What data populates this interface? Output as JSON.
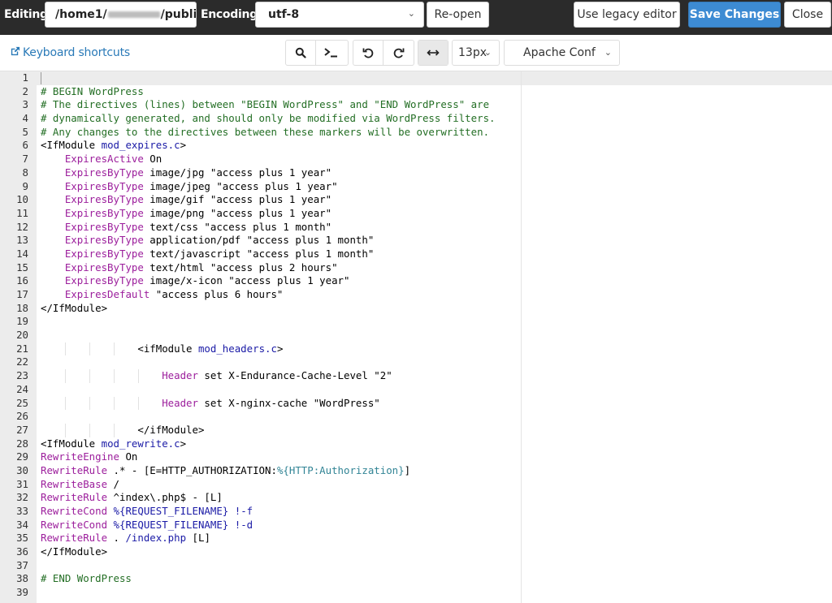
{
  "topbar": {
    "editing_label": "Editing:",
    "path_prefix": "/home1/",
    "path_suffix": "/publi",
    "encoding_label": "Encoding:",
    "encoding_value": "utf-8",
    "reopen_label": "Re-open",
    "legacy_label": "Use legacy editor",
    "save_label": "Save Changes",
    "close_label": "Close",
    "accent_color": "#3d8bd3"
  },
  "toolbar": {
    "keyboard_shortcuts_label": "Keyboard shortcuts",
    "font_size_value": "13px",
    "mode_value": "Apache Conf",
    "icons": [
      "search-icon",
      "terminal-icon",
      "undo-icon",
      "redo-icon",
      "wrap-toggle-icon"
    ]
  },
  "editor": {
    "lines": [
      {
        "n": "1",
        "tokens": []
      },
      {
        "n": "2",
        "tokens": [
          {
            "t": "# BEGIN WordPress",
            "c": "c-comment"
          }
        ]
      },
      {
        "n": "3",
        "tokens": [
          {
            "t": "# The directives (lines) between \"BEGIN WordPress\" and \"END WordPress\" are",
            "c": "c-comment"
          }
        ]
      },
      {
        "n": "4",
        "tokens": [
          {
            "t": "# dynamically generated, and should only be modified via WordPress filters.",
            "c": "c-comment"
          }
        ]
      },
      {
        "n": "5",
        "tokens": [
          {
            "t": "# Any changes to the directives between these markers will be overwritten.",
            "c": "c-comment"
          }
        ]
      },
      {
        "n": "6",
        "tokens": [
          {
            "t": "<IfModule ",
            "c": ""
          },
          {
            "t": "mod_expires.c",
            "c": "c-mod"
          },
          {
            "t": ">",
            "c": ""
          }
        ]
      },
      {
        "n": "7",
        "tokens": [
          {
            "t": "    ",
            "c": ""
          },
          {
            "t": "ExpiresActive",
            "c": "c-kw"
          },
          {
            "t": " On",
            "c": ""
          }
        ]
      },
      {
        "n": "8",
        "tokens": [
          {
            "t": "    ",
            "c": ""
          },
          {
            "t": "ExpiresByType",
            "c": "c-kw"
          },
          {
            "t": " image/jpg \"access plus 1 year\"",
            "c": ""
          }
        ]
      },
      {
        "n": "9",
        "tokens": [
          {
            "t": "    ",
            "c": ""
          },
          {
            "t": "ExpiresByType",
            "c": "c-kw"
          },
          {
            "t": " image/jpeg \"access plus 1 year\"",
            "c": ""
          }
        ]
      },
      {
        "n": "10",
        "tokens": [
          {
            "t": "    ",
            "c": ""
          },
          {
            "t": "ExpiresByType",
            "c": "c-kw"
          },
          {
            "t": " image/gif \"access plus 1 year\"",
            "c": ""
          }
        ]
      },
      {
        "n": "11",
        "tokens": [
          {
            "t": "    ",
            "c": ""
          },
          {
            "t": "ExpiresByType",
            "c": "c-kw"
          },
          {
            "t": " image/png \"access plus 1 year\"",
            "c": ""
          }
        ]
      },
      {
        "n": "12",
        "tokens": [
          {
            "t": "    ",
            "c": ""
          },
          {
            "t": "ExpiresByType",
            "c": "c-kw"
          },
          {
            "t": " text/css \"access plus 1 month\"",
            "c": ""
          }
        ]
      },
      {
        "n": "13",
        "tokens": [
          {
            "t": "    ",
            "c": ""
          },
          {
            "t": "ExpiresByType",
            "c": "c-kw"
          },
          {
            "t": " application/pdf \"access plus 1 month\"",
            "c": ""
          }
        ]
      },
      {
        "n": "14",
        "tokens": [
          {
            "t": "    ",
            "c": ""
          },
          {
            "t": "ExpiresByType",
            "c": "c-kw"
          },
          {
            "t": " text/javascript \"access plus 1 month\"",
            "c": ""
          }
        ]
      },
      {
        "n": "15",
        "tokens": [
          {
            "t": "    ",
            "c": ""
          },
          {
            "t": "ExpiresByType",
            "c": "c-kw"
          },
          {
            "t": " text/html \"access plus 2 hours\"",
            "c": ""
          }
        ]
      },
      {
        "n": "16",
        "tokens": [
          {
            "t": "    ",
            "c": ""
          },
          {
            "t": "ExpiresByType",
            "c": "c-kw"
          },
          {
            "t": " image/x-icon \"access plus 1 year\"",
            "c": ""
          }
        ]
      },
      {
        "n": "17",
        "tokens": [
          {
            "t": "    ",
            "c": ""
          },
          {
            "t": "ExpiresDefault",
            "c": "c-kw"
          },
          {
            "t": " \"access plus 6 hours\"",
            "c": ""
          }
        ]
      },
      {
        "n": "18",
        "tokens": [
          {
            "t": "</IfModule>",
            "c": ""
          }
        ]
      },
      {
        "n": "19",
        "tokens": []
      },
      {
        "n": "20",
        "tokens": []
      },
      {
        "n": "21",
        "guides": 3,
        "tokens": [
          {
            "t": "                ",
            "c": ""
          },
          {
            "t": "<ifModule ",
            "c": ""
          },
          {
            "t": "mod_headers.c",
            "c": "c-mod"
          },
          {
            "t": ">",
            "c": ""
          }
        ]
      },
      {
        "n": "22",
        "tokens": []
      },
      {
        "n": "23",
        "guides": 4,
        "tokens": [
          {
            "t": "                    ",
            "c": ""
          },
          {
            "t": "Header",
            "c": "c-kw"
          },
          {
            "t": " set X-Endurance-Cache-Level \"2\"",
            "c": ""
          }
        ]
      },
      {
        "n": "24",
        "tokens": []
      },
      {
        "n": "25",
        "guides": 4,
        "tokens": [
          {
            "t": "                    ",
            "c": ""
          },
          {
            "t": "Header",
            "c": "c-kw"
          },
          {
            "t": " set X-nginx-cache \"WordPress\"",
            "c": ""
          }
        ]
      },
      {
        "n": "26",
        "tokens": []
      },
      {
        "n": "27",
        "guides": 3,
        "tokens": [
          {
            "t": "                ",
            "c": ""
          },
          {
            "t": "</ifModule>",
            "c": ""
          }
        ]
      },
      {
        "n": "28",
        "tokens": [
          {
            "t": "<IfModule ",
            "c": ""
          },
          {
            "t": "mod_rewrite.c",
            "c": "c-mod"
          },
          {
            "t": ">",
            "c": ""
          }
        ]
      },
      {
        "n": "29",
        "tokens": [
          {
            "t": "RewriteEngine",
            "c": "c-kw"
          },
          {
            "t": " On",
            "c": ""
          }
        ]
      },
      {
        "n": "30",
        "tokens": [
          {
            "t": "RewriteRule",
            "c": "c-kw"
          },
          {
            "t": " .* - [E=HTTP_AUTHORIZATION:",
            "c": ""
          },
          {
            "t": "%{HTTP:Authorization}",
            "c": "c-var"
          },
          {
            "t": "]",
            "c": ""
          }
        ]
      },
      {
        "n": "31",
        "tokens": [
          {
            "t": "RewriteBase",
            "c": "c-kw"
          },
          {
            "t": " /",
            "c": ""
          }
        ]
      },
      {
        "n": "32",
        "tokens": [
          {
            "t": "RewriteRule",
            "c": "c-kw"
          },
          {
            "t": " ^index\\.php$ - [L]",
            "c": ""
          }
        ]
      },
      {
        "n": "33",
        "tokens": [
          {
            "t": "RewriteCond",
            "c": "c-kw"
          },
          {
            "t": " ",
            "c": ""
          },
          {
            "t": "%{REQUEST_FILENAME}",
            "c": "c-var2"
          },
          {
            "t": " !-f",
            "c": "c-var2"
          }
        ]
      },
      {
        "n": "34",
        "tokens": [
          {
            "t": "RewriteCond",
            "c": "c-kw"
          },
          {
            "t": " ",
            "c": ""
          },
          {
            "t": "%{REQUEST_FILENAME}",
            "c": "c-var2"
          },
          {
            "t": " !-d",
            "c": "c-var2"
          }
        ]
      },
      {
        "n": "35",
        "tokens": [
          {
            "t": "RewriteRule",
            "c": "c-kw"
          },
          {
            "t": " . ",
            "c": ""
          },
          {
            "t": "/index.php",
            "c": "c-var2"
          },
          {
            "t": " [L]",
            "c": ""
          }
        ]
      },
      {
        "n": "36",
        "tokens": [
          {
            "t": "</IfModule>",
            "c": ""
          }
        ]
      },
      {
        "n": "37",
        "tokens": []
      },
      {
        "n": "38",
        "tokens": [
          {
            "t": "# END WordPress",
            "c": "c-comment"
          }
        ]
      },
      {
        "n": "39",
        "tokens": []
      }
    ]
  }
}
